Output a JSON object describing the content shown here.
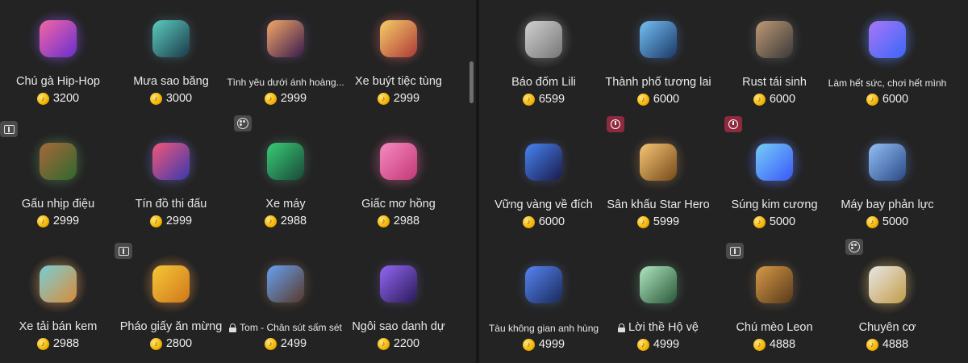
{
  "left_gifts": [
    {
      "name": "Chú gà Hip-Hop",
      "price": "3200",
      "colors": [
        "#ff6aa8",
        "#6b2fd6"
      ]
    },
    {
      "name": "Mưa sao băng",
      "price": "3000",
      "colors": [
        "#5fd6c8",
        "#1b3b4a"
      ]
    },
    {
      "name": "Tình yêu dưới ánh hoàng...",
      "price": "2999",
      "colors": [
        "#ffb06b",
        "#3a1a4e"
      ],
      "small": true
    },
    {
      "name": "Xe buýt tiệc tùng",
      "price": "2999",
      "colors": [
        "#ffd86b",
        "#b33a3a"
      ]
    },
    {
      "name": "Gấu nhịp điệu",
      "price": "2999",
      "colors": [
        "#b06b3a",
        "#2f6b2f"
      ]
    },
    {
      "name": "Tín đồ thi đấu",
      "price": "2999",
      "colors": [
        "#ff5a7a",
        "#3a3ab3"
      ]
    },
    {
      "name": "Xe máy",
      "price": "2988",
      "colors": [
        "#3ad67a",
        "#1a4a3a"
      ]
    },
    {
      "name": "Giấc mơ hồng",
      "price": "2988",
      "colors": [
        "#ff8fc8",
        "#c83a7a"
      ]
    },
    {
      "name": "Xe tải bán kem",
      "price": "2988",
      "colors": [
        "#7ad6e0",
        "#e08f3a"
      ]
    },
    {
      "name": "Pháo giấy ăn mừng",
      "price": "2800",
      "colors": [
        "#ffcf3a",
        "#d67a1a"
      ]
    },
    {
      "name": "Tom - Chân sút sấm sét",
      "price": "2499",
      "colors": [
        "#6ba8ff",
        "#5a3a2a"
      ],
      "small": true,
      "locked": true
    },
    {
      "name": "Ngôi sao danh dự",
      "price": "2200",
      "colors": [
        "#9a6bff",
        "#2a1a5a"
      ]
    }
  ],
  "right_gifts": [
    {
      "name": "Báo đốm Lili",
      "price": "6599",
      "colors": [
        "#d8d8d8",
        "#7a7a7a"
      ]
    },
    {
      "name": "Thành phố tương lai",
      "price": "6000",
      "colors": [
        "#7ac8ff",
        "#1a3a6a"
      ]
    },
    {
      "name": "Rust tái sinh",
      "price": "6000",
      "colors": [
        "#c8a07a",
        "#3a3a3a"
      ]
    },
    {
      "name": "Làm hết sức, chơi hết mình",
      "price": "6000",
      "colors": [
        "#b07aff",
        "#3a6aff"
      ],
      "small": true
    },
    {
      "name": "Vững vàng về đích",
      "price": "6000",
      "colors": [
        "#4a8aff",
        "#1a1a4a"
      ]
    },
    {
      "name": "Sân khấu Star Hero",
      "price": "5999",
      "colors": [
        "#ffcf7a",
        "#7a4a1a"
      ]
    },
    {
      "name": "Súng kim cương",
      "price": "5000",
      "colors": [
        "#7ad6ff",
        "#3a5aff"
      ]
    },
    {
      "name": "Máy bay phản lực",
      "price": "5000",
      "colors": [
        "#9ac8ff",
        "#2a4a8a"
      ]
    },
    {
      "name": "Tàu không gian anh hùng",
      "price": "4999",
      "colors": [
        "#5a8aff",
        "#1a2a5a"
      ],
      "small": true
    },
    {
      "name": "Lời thề Hộ vệ",
      "price": "4999",
      "colors": [
        "#b8f0c8",
        "#2a5a3a"
      ],
      "locked": true
    },
    {
      "name": "Chú mèo Leon",
      "price": "4888",
      "colors": [
        "#e0a04a",
        "#5a3a1a"
      ]
    },
    {
      "name": "Chuyên cơ",
      "price": "4888",
      "colors": [
        "#f0f0f0",
        "#c8a04a"
      ]
    }
  ],
  "badges": [
    {
      "panel": "left",
      "index": 4,
      "type": "video",
      "color": "#4a4a4a"
    },
    {
      "panel": "left",
      "index": 6,
      "type": "palette",
      "color": "#4a4a4a"
    },
    {
      "panel": "left",
      "index": 9,
      "type": "video",
      "color": "#4a4a4a"
    },
    {
      "panel": "right",
      "index": 5,
      "type": "clock",
      "color": "#8f2a3e"
    },
    {
      "panel": "right",
      "index": 6,
      "type": "clock",
      "color": "#8f2a3e"
    },
    {
      "panel": "right",
      "index": 10,
      "type": "video",
      "color": "#4a4a4a"
    },
    {
      "panel": "right",
      "index": 11,
      "type": "palette",
      "color": "#4a4a4a"
    }
  ],
  "coin_icon": "coin-icon"
}
